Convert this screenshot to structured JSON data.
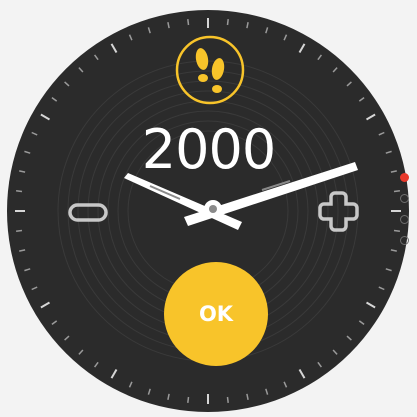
{
  "goal": {
    "value": "2000",
    "icon": "footsteps-icon"
  },
  "controls": {
    "decrease_icon": "minus-icon",
    "increase_icon": "plus-icon",
    "ok_label": "OK"
  },
  "pagination": {
    "count": 4,
    "active_index": 0
  },
  "colors": {
    "accent": "#f8c42a",
    "face": "#2b2b2b",
    "active_dot": "#e8392b",
    "text": "#ffffff"
  }
}
